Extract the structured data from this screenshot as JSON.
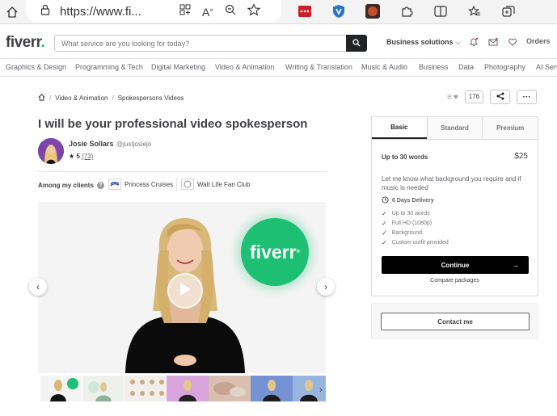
{
  "browser": {
    "url": "https://www.fi...",
    "colors": {
      "chrome_bg": "#f3f3f3"
    }
  },
  "header": {
    "logo_text": "fiverr",
    "logo_dot": ".",
    "search_placeholder": "What service are you looking for today?",
    "business_label": "Business solutions",
    "orders_label": "Orders"
  },
  "categories": [
    "Graphics & Design",
    "Programming & Tech",
    "Digital Marketing",
    "Video & Animation",
    "Writing & Translation",
    "Music & Audio",
    "Business",
    "Data",
    "Photography",
    "AI Serv"
  ],
  "breadcrumb": {
    "items": [
      "Video & Animation",
      "Spokespersons Videos"
    ],
    "separator": "/"
  },
  "actions": {
    "like_count": "176"
  },
  "gig": {
    "title": "I will be your professional video spokesperson",
    "seller_name": "Josie Sollars",
    "seller_username": "@justjosiejo",
    "rating_star": "★",
    "rating": "5",
    "reviews": "(73)",
    "clients_label": "Among my clients",
    "clients": [
      "Princess Cruises",
      "Walt Life Fan Club"
    ],
    "media_logo": "fiverr"
  },
  "package": {
    "tabs": [
      "Basic",
      "Standard",
      "Premium"
    ],
    "active_tab": "Basic",
    "title": "Up to 30 words",
    "price": "$25",
    "description": "Let me know what background you require and if music is needed",
    "delivery": "6 Days Delivery",
    "features": [
      "Up to 30 words",
      "Full HD (1080p)",
      "Background",
      "Custom outfit provided"
    ],
    "continue_label": "Continue",
    "compare_label": "Compare packages"
  },
  "contact_label": "Contact me",
  "colors": {
    "brand_green": "#1dbf73",
    "text_dark": "#404145",
    "button_black": "#000000"
  }
}
